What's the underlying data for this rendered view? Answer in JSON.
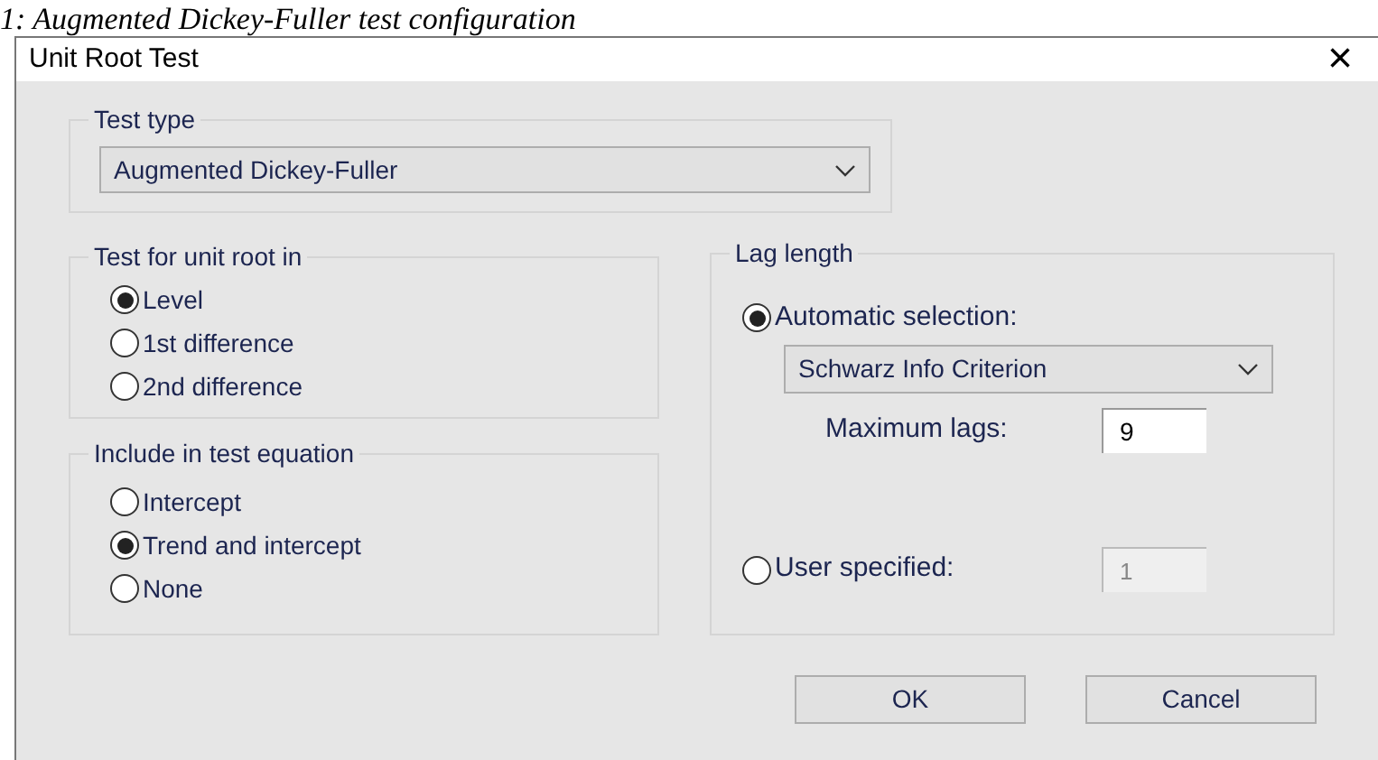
{
  "caption": "1: Augmented Dickey-Fuller test configuration",
  "window": {
    "title": "Unit Root Test",
    "close": "×"
  },
  "test_type": {
    "label": "Test type",
    "value": "Augmented Dickey-Fuller"
  },
  "unit_root_in": {
    "label": "Test for unit root in",
    "options": [
      {
        "label": "Level",
        "selected": true
      },
      {
        "label": "1st difference",
        "selected": false
      },
      {
        "label": "2nd difference",
        "selected": false
      }
    ]
  },
  "include_in_equation": {
    "label": "Include in test equation",
    "options": [
      {
        "label": "Intercept",
        "selected": false
      },
      {
        "label": "Trend and intercept",
        "selected": true
      },
      {
        "label": "None",
        "selected": false
      }
    ]
  },
  "lag_length": {
    "label": "Lag length",
    "automatic": {
      "label": "Automatic selection:",
      "selected": true,
      "criterion": "Schwarz Info Criterion",
      "max_lags_label": "Maximum lags:",
      "max_lags": "9"
    },
    "user": {
      "label": "User specified:",
      "selected": false,
      "value": "1",
      "disabled": true
    }
  },
  "buttons": [
    "OK",
    "Cancel"
  ]
}
